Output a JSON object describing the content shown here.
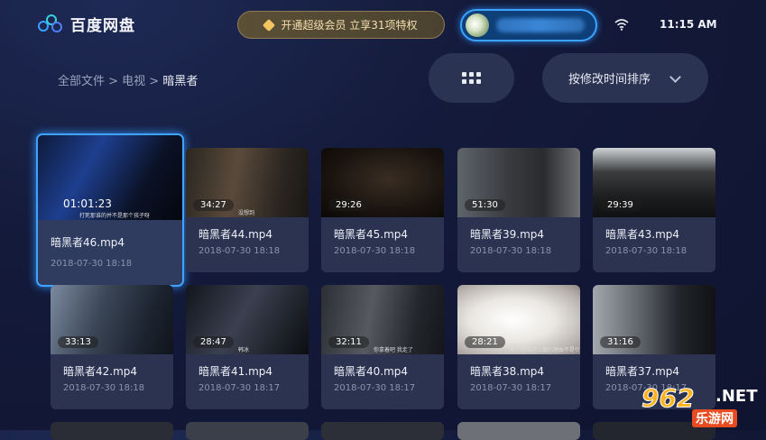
{
  "header": {
    "app_name": "百度网盘",
    "vip_promo": "开通超级会员 立享31项特权",
    "time": "11:15 AM"
  },
  "breadcrumb": {
    "path": "全部文件 > 电视 > ",
    "current": "暗黑者"
  },
  "controls": {
    "sort_label": "按修改时间排序"
  },
  "files": [
    {
      "name": "暗黑者46.mp4",
      "date": "2018-07-30  18:18",
      "duration": "01:01:23",
      "caption": "打死那谁的并不是那个孩子呀"
    },
    {
      "name": "暗黑者44.mp4",
      "date": "2018-07-30  18:18",
      "duration": "34:27",
      "caption": "没想到"
    },
    {
      "name": "暗黑者45.mp4",
      "date": "2018-07-30  18:18",
      "duration": "29:26",
      "caption": ""
    },
    {
      "name": "暗黑者39.mp4",
      "date": "2018-07-30  18:18",
      "duration": "51:30",
      "caption": ""
    },
    {
      "name": "暗黑者43.mp4",
      "date": "2018-07-30  18:18",
      "duration": "29:39",
      "caption": ""
    },
    {
      "name": "暗黑者42.mp4",
      "date": "2018-07-30  18:18",
      "duration": "33:13",
      "caption": ""
    },
    {
      "name": "暗黑者41.mp4",
      "date": "2018-07-30  18:17",
      "duration": "28:47",
      "caption": "韩冰"
    },
    {
      "name": "暗黑者40.mp4",
      "date": "2018-07-30  18:17",
      "duration": "32:11",
      "caption": "你拿着吧  我走了"
    },
    {
      "name": "暗黑者38.mp4",
      "date": "2018-07-30  18:17",
      "duration": "28:21",
      "caption": "我不想做这么做的理由不是什么"
    },
    {
      "name": "暗黑者37.mp4",
      "date": "2018-07-30  18:17",
      "duration": "31:16",
      "caption": ""
    }
  ],
  "watermark": {
    "number": "962",
    "domain": ".NET",
    "site": "乐游网"
  },
  "colors": {
    "accent": "#3fa4ff",
    "vip_gold": "#f4dfae",
    "card_bg": "#2b3350"
  }
}
